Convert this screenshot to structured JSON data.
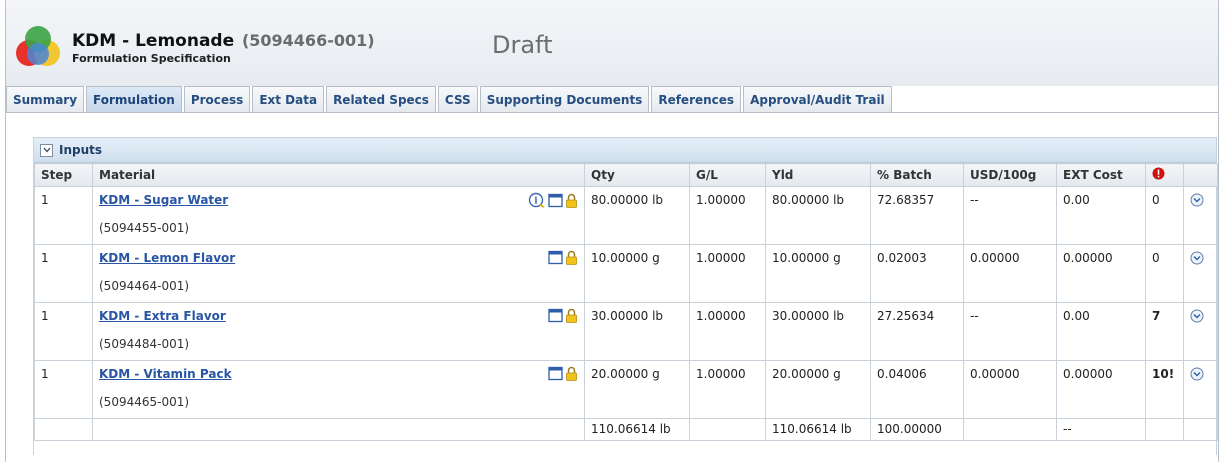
{
  "header": {
    "title": "KDM - Lemonade",
    "spec_id": "(5094466-001)",
    "subtitle": "Formulation Specification",
    "status": "Draft"
  },
  "tabs": [
    {
      "label": "Summary"
    },
    {
      "label": "Formulation",
      "active": true
    },
    {
      "label": "Process"
    },
    {
      "label": "Ext Data"
    },
    {
      "label": "Related Specs"
    },
    {
      "label": "CSS"
    },
    {
      "label": "Supporting Documents"
    },
    {
      "label": "References"
    },
    {
      "label": "Approval/Audit Trail"
    }
  ],
  "inputs": {
    "section_title": "Inputs",
    "columns": {
      "step": "Step",
      "material": "Material",
      "qty": "Qty",
      "gl": "G/L",
      "yld": "Yld",
      "batch": "% Batch",
      "usd": "USD/100g",
      "ext_cost": "EXT Cost"
    },
    "rows": [
      {
        "step": "1",
        "name": "KDM - Sugar Water",
        "code": "(5094455-001)",
        "qty": "80.00000 lb",
        "gl": "1.00000",
        "yld": "80.00000 lb",
        "batch": "72.68357",
        "usd": "--",
        "ext_cost": "0.00",
        "alerts": "0"
      },
      {
        "step": "1",
        "name": "KDM - Lemon Flavor",
        "code": "(5094464-001)",
        "qty": "10.00000 g",
        "gl": "1.00000",
        "yld": "10.00000 g",
        "batch": "0.02003",
        "usd": "0.00000",
        "ext_cost": "0.00000",
        "alerts": "0"
      },
      {
        "step": "1",
        "name": "KDM - Extra Flavor",
        "code": "(5094484-001)",
        "qty": "30.00000 lb",
        "gl": "1.00000",
        "yld": "30.00000 lb",
        "batch": "27.25634",
        "usd": "--",
        "ext_cost": "0.00",
        "alerts": "7"
      },
      {
        "step": "1",
        "name": "KDM - Vitamin Pack",
        "code": "(5094465-001)",
        "qty": "20.00000 g",
        "gl": "1.00000",
        "yld": "20.00000 g",
        "batch": "0.04006",
        "usd": "0.00000",
        "ext_cost": "0.00000",
        "alerts": "10!"
      }
    ],
    "totals": {
      "qty": "110.06614 lb",
      "yld": "110.06614 lb",
      "batch": "100.00000",
      "ext_cost": "--"
    }
  },
  "colors": {
    "link": "#2855a4",
    "alert": "#cc1111",
    "tab_text": "#264e80"
  }
}
